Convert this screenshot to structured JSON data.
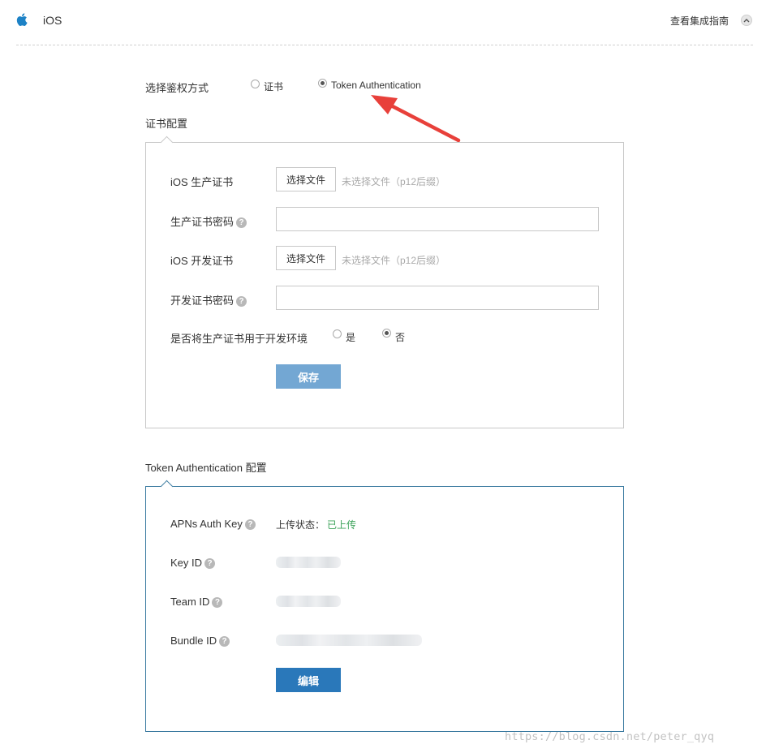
{
  "header": {
    "title": "iOS",
    "guide_link": "查看集成指南"
  },
  "auth": {
    "label": "选择鉴权方式",
    "options": [
      {
        "label": "证书",
        "checked": false
      },
      {
        "label": "Token Authentication",
        "checked": true
      }
    ]
  },
  "cert_section": {
    "title": "证书配置",
    "prod_cert_label": "iOS 生产证书",
    "prod_cert_button": "选择文件",
    "prod_cert_hint": "未选择文件（p12后缀）",
    "prod_password_label": "生产证书密码",
    "dev_cert_label": "iOS 开发证书",
    "dev_cert_button": "选择文件",
    "dev_cert_hint": "未选择文件（p12后缀）",
    "dev_password_label": "开发证书密码",
    "use_prod_for_dev_label": "是否将生产证书用于开发环境",
    "yes_label": "是",
    "no_label": "否",
    "selected": "否",
    "save_button": "保存"
  },
  "token_section": {
    "title": "Token Authentication 配置",
    "apns_key_label": "APNs Auth Key",
    "upload_status_label": "上传状态：",
    "upload_status_value": "已上传",
    "key_id_label": "Key ID",
    "team_id_label": "Team ID",
    "bundle_id_label": "Bundle ID",
    "edit_button": "编辑"
  },
  "help_glyph": "?",
  "watermark": "https://blog.csdn.net/peter_qyq",
  "colors": {
    "save_button": "#73a7d3",
    "edit_button": "#2a78ba",
    "status_ok": "#3ca35a",
    "arrow": "#e8403a",
    "token_panel_border": "#3a7aa0"
  }
}
